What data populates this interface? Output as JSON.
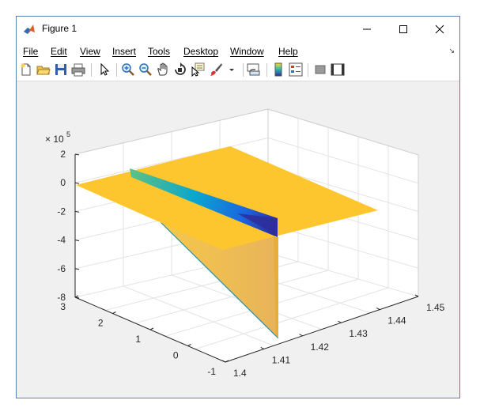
{
  "window": {
    "title": "Figure 1"
  },
  "menu": [
    "File",
    "Edit",
    "View",
    "Insert",
    "Tools",
    "Desktop",
    "Window",
    "Help"
  ],
  "toolbar": [
    "new-figure",
    "open-file",
    "save",
    "print",
    "edit-plot",
    "zoom-in",
    "zoom-out",
    "pan",
    "rotate-3d",
    "data-cursor",
    "brush",
    "brush-menu",
    "link-plot",
    "colorbar",
    "legend",
    "hide-plot-tools",
    "show-plot-tools"
  ],
  "chart_data": {
    "type": "surface",
    "exponent_label": "× 10",
    "exponent": "5",
    "x_ticks": [
      "1.4",
      "1.41",
      "1.42",
      "1.43",
      "1.44",
      "1.45"
    ],
    "y_ticks": [
      "-1",
      "0",
      "1",
      "2",
      "3"
    ],
    "z_ticks": [
      "2",
      "0",
      "-2",
      "-4",
      "-6",
      "-8"
    ],
    "xlim": [
      1.4,
      1.45
    ],
    "ylim": [
      -1,
      3
    ],
    "zlim": [
      -800000,
      200000
    ],
    "grid": true,
    "colors": {
      "plane": "#fdc62e",
      "ridge_start": "#5fc281",
      "ridge_mid": "#09a6cf",
      "ridge_end": "#2c2c9e"
    }
  }
}
